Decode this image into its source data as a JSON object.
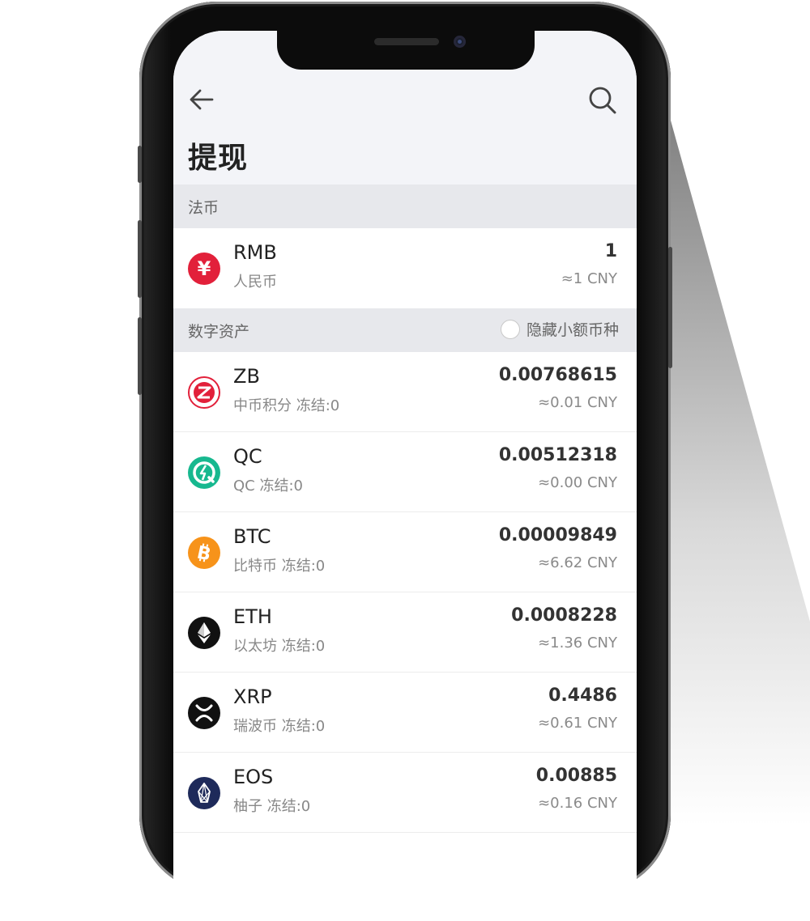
{
  "header": {
    "title": "提现"
  },
  "fiat_section": {
    "label": "法币"
  },
  "digital_section": {
    "label": "数字资产",
    "hide_small_label": "隐藏小额币种"
  },
  "fiat_rows": [
    {
      "symbol": "RMB",
      "name": "人民币",
      "amount": "1",
      "cny": "≈1 CNY",
      "icon": "yen-icon",
      "color": "#e2203a"
    }
  ],
  "coins": [
    {
      "symbol": "ZB",
      "name": "中币积分 冻结:0",
      "amount": "0.00768615",
      "cny": "≈0.01 CNY",
      "icon": "zb-icon",
      "color": "#e2203a"
    },
    {
      "symbol": "QC",
      "name": "QC 冻结:0",
      "amount": "0.00512318",
      "cny": "≈0.00 CNY",
      "icon": "qc-icon",
      "color": "#17b88f"
    },
    {
      "symbol": "BTC",
      "name": "比特币 冻结:0",
      "amount": "0.00009849",
      "cny": "≈6.62 CNY",
      "icon": "bitcoin-icon",
      "color": "#f7931a"
    },
    {
      "symbol": "ETH",
      "name": "以太坊 冻结:0",
      "amount": "0.0008228",
      "cny": "≈1.36 CNY",
      "icon": "ethereum-icon",
      "color": "#111111"
    },
    {
      "symbol": "XRP",
      "name": "瑞波币 冻结:0",
      "amount": "0.4486",
      "cny": "≈0.61 CNY",
      "icon": "xrp-icon",
      "color": "#111111"
    },
    {
      "symbol": "EOS",
      "name": "柚子 冻结:0",
      "amount": "0.00885",
      "cny": "≈0.16 CNY",
      "icon": "eos-icon",
      "color": "#1e2a5a"
    }
  ]
}
